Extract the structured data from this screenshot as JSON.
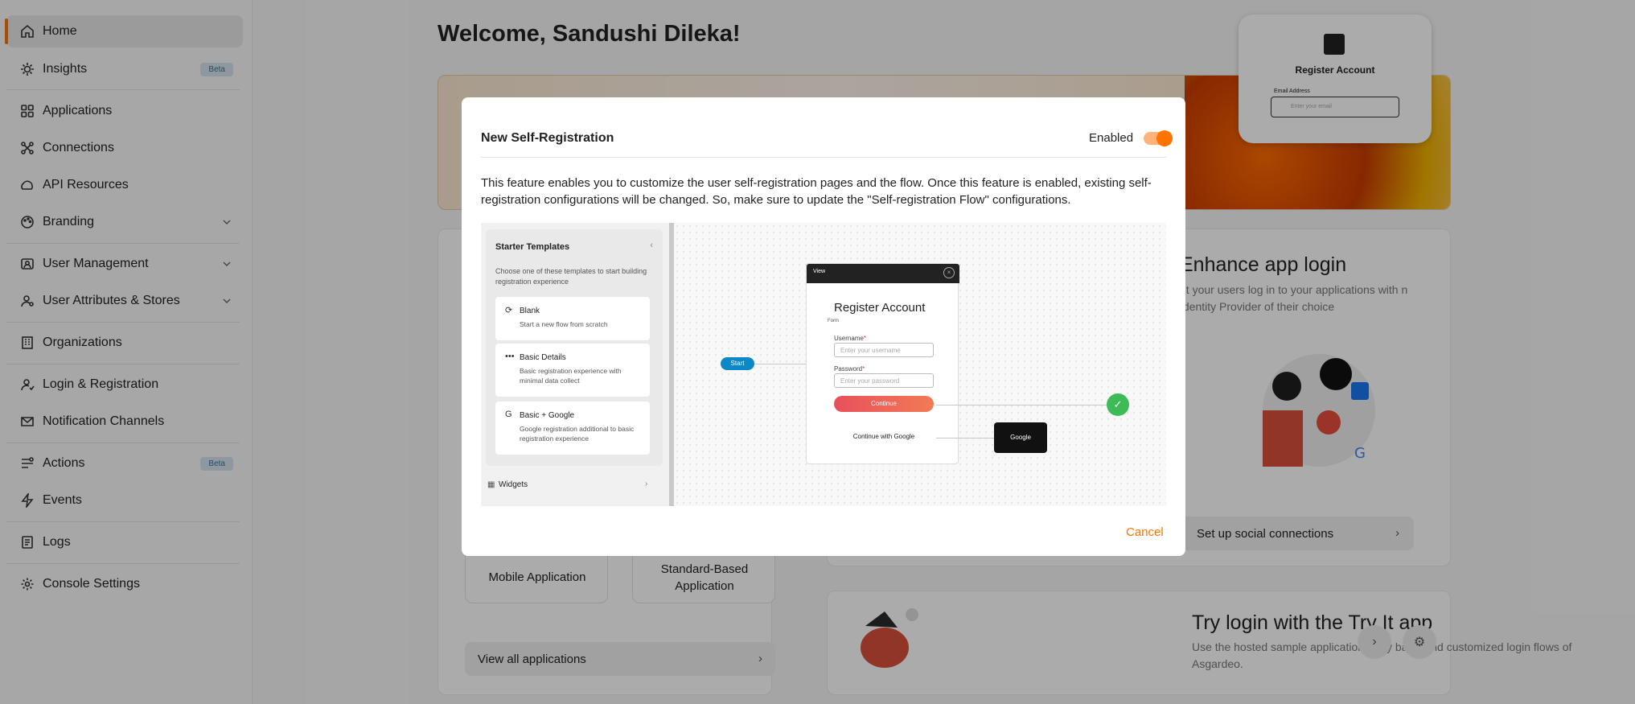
{
  "sidebar": {
    "items": [
      {
        "label": "Home",
        "icon": "home-icon",
        "active": true
      },
      {
        "label": "Insights",
        "icon": "insights-icon",
        "badge": "Beta"
      },
      {
        "label": "Applications",
        "icon": "applications-icon"
      },
      {
        "label": "Connections",
        "icon": "connections-icon"
      },
      {
        "label": "API Resources",
        "icon": "api-resources-icon"
      },
      {
        "label": "Branding",
        "icon": "branding-icon",
        "expandable": true
      },
      {
        "label": "User Management",
        "icon": "user-management-icon",
        "expandable": true
      },
      {
        "label": "User Attributes & Stores",
        "icon": "user-attributes-icon",
        "expandable": true
      },
      {
        "label": "Organizations",
        "icon": "organizations-icon"
      },
      {
        "label": "Login & Registration",
        "icon": "login-registration-icon"
      },
      {
        "label": "Notification Channels",
        "icon": "notification-channels-icon"
      },
      {
        "label": "Actions",
        "icon": "actions-icon",
        "badge": "Beta"
      },
      {
        "label": "Events",
        "icon": "events-icon"
      },
      {
        "label": "Logs",
        "icon": "logs-icon"
      },
      {
        "label": "Console Settings",
        "icon": "console-settings-icon"
      }
    ]
  },
  "main": {
    "welcome": "Welcome, Sandushi Dileka!",
    "banner_card": {
      "title": "Register Account",
      "email_label": "Email Address",
      "email_placeholder": "Enter your email"
    },
    "enhance": {
      "title": "Enhance app login",
      "subtitle": "et your users log in to your applications with n Identity Provider of their choice",
      "button": "Set up social connections"
    },
    "app_tiles": [
      "Mobile Application",
      "Standard-Based Application"
    ],
    "view_all": "View all applications",
    "try_it": {
      "title": "Try login with the Try It app",
      "subtitle": "Use the hosted sample application to try basic and customized login flows of Asgardeo."
    }
  },
  "modal": {
    "title": "New Self-Registration",
    "toggle_label": "Enabled",
    "toggle_on": true,
    "description": "This feature enables you to customize the user self-registration pages and the flow. Once this feature is enabled, existing self-registration configurations will be changed. So, make sure to update the \"Self-registration Flow\" configurations.",
    "cancel": "Cancel",
    "preview": {
      "panel_title": "Starter Templates",
      "panel_sub": "Choose one of these templates to start building registration experience",
      "templates": [
        {
          "title": "Blank",
          "desc": "Start a new flow from scratch",
          "icon": "refresh-icon"
        },
        {
          "title": "Basic Details",
          "desc": "Basic registration experience with minimal data collect",
          "icon": "dots-icon"
        },
        {
          "title": "Basic + Google",
          "desc": "Google registration additional to basic registration experience",
          "icon": "google-icon"
        }
      ],
      "widgets": "Widgets",
      "start": "Start",
      "view_header": "View",
      "view_title": "Register Account",
      "form_label": "Form",
      "username_label": "Username",
      "username_placeholder": "Enter your username",
      "password_label": "Password",
      "password_placeholder": "Enter your password",
      "continue": "Continue",
      "continue_google": "Continue with Google",
      "google_node": "Google"
    }
  },
  "colors": {
    "accent": "#ff7300",
    "start": "#0a88c8",
    "success": "#3dbb57"
  }
}
